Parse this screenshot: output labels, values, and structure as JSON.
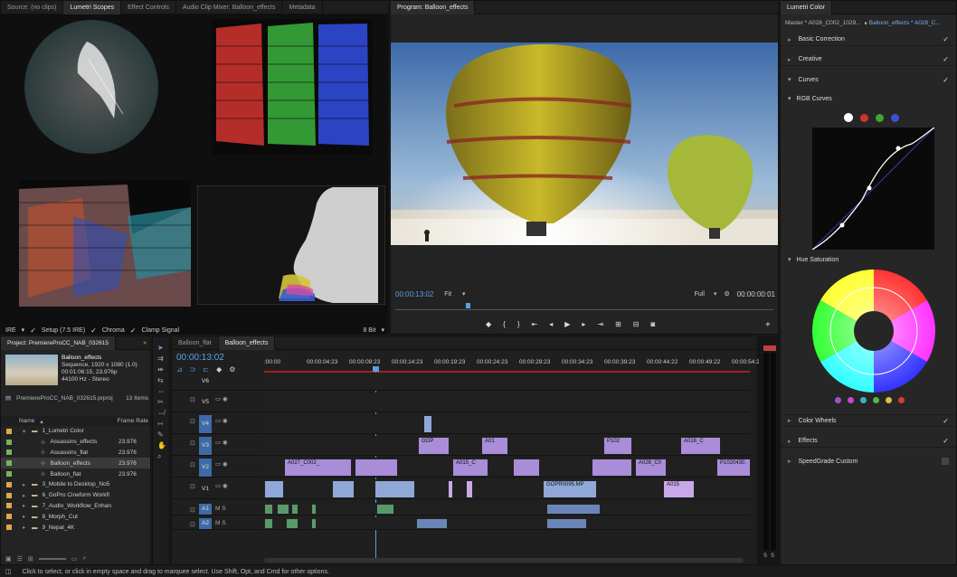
{
  "scopes": {
    "tabs": [
      "Source: (no clips)",
      "Lumetri Scopes",
      "Effect Controls",
      "Audio Clip Mixer: Balloon_effects",
      "Metadata"
    ],
    "bottom": {
      "ire": "IRE",
      "setup": "Setup (7.5 IRE)",
      "chroma": "Chroma",
      "clamp": "Clamp Signal",
      "bits": "8 Bit"
    }
  },
  "program": {
    "tab": "Program: Balloon_effects",
    "timecode": "00:00:13:02",
    "fit": "Fit",
    "quality": "Full",
    "duration": "00:00:00:01"
  },
  "lumetri": {
    "tab": "Lumetri Color",
    "master": "Master * A028_C002_1029...",
    "clip": "Balloon_effects * A028_C...",
    "sections": {
      "basic": "Basic Correction",
      "creative": "Creative",
      "curves": "Curves",
      "rgb": "RGB Curves",
      "hue": "Hue Saturation",
      "wheels": "Color Wheels",
      "effects": "Effects",
      "speedgrade": "SpeedGrade Custom"
    },
    "curve_colors": [
      "#ffffff",
      "#d2332e",
      "#3fa535",
      "#3c4fd6"
    ],
    "hue_dots": [
      "#a34fd1",
      "#c64ad0",
      "#3fb0c8",
      "#4fb84a",
      "#d7c43d",
      "#d24032"
    ]
  },
  "project": {
    "title": "Project: PremiereProCC_NAB_032615",
    "clip_name": "Balloon_effects",
    "clip_info1": "Sequence, 1920 x 1080 (1.0)",
    "clip_info2": "00:01:06:15, 23.976p",
    "clip_info3": "44100 Hz - Stereo",
    "proj_file": "PremiereProCC_NAB_032615.prproj",
    "items_count": "13 Items",
    "col_name": "Name",
    "col_rate": "Frame Rate",
    "items": [
      {
        "name": "1_Lumetri Color",
        "rate": "",
        "color": "#e0a84a",
        "indent": 0,
        "folder": true
      },
      {
        "name": "Assassins_effects",
        "rate": "23.976",
        "color": "#76b35c",
        "indent": 1,
        "folder": false
      },
      {
        "name": "Assassins_flat",
        "rate": "23.976",
        "color": "#76b35c",
        "indent": 1,
        "folder": false
      },
      {
        "name": "Balloon_effects",
        "rate": "23.976",
        "color": "#76b35c",
        "indent": 1,
        "folder": false
      },
      {
        "name": "Balloon_flat",
        "rate": "23.976",
        "color": "#76b35c",
        "indent": 1,
        "folder": false
      },
      {
        "name": "3_Mobile to Desktop_No5",
        "rate": "",
        "color": "#e0a84a",
        "indent": 0,
        "folder": true
      },
      {
        "name": "6_GoPro Cineform Workfl",
        "rate": "",
        "color": "#e0a84a",
        "indent": 0,
        "folder": true
      },
      {
        "name": "7_Audio_Workflow_Enhan",
        "rate": "",
        "color": "#e0a84a",
        "indent": 0,
        "folder": true
      },
      {
        "name": "8_Morph_Cut",
        "rate": "",
        "color": "#e0a84a",
        "indent": 0,
        "folder": true
      },
      {
        "name": "9_Nepal_4K",
        "rate": "",
        "color": "#e0a84a",
        "indent": 0,
        "folder": true
      }
    ]
  },
  "timeline": {
    "tabs": [
      "Balloon_flat",
      "Balloon_effects"
    ],
    "timecode": "00:00:13:02",
    "ruler": [
      ":00:00",
      "00:00:04:23",
      "00:00:09:23",
      "00:00:14:23",
      "00:00:19:23",
      "00:00:24:23",
      "00:00:29:23",
      "00:00:34:23",
      "00:00:39:23",
      "00:00:44:22",
      "00:00:49:22",
      "00:00:54:22"
    ],
    "tracks": [
      "V6",
      "V5",
      "V4",
      "V3",
      "V2",
      "V1",
      "A1",
      "A2"
    ],
    "clip_labels": {
      "gop1": "GOP",
      "a01": "A01",
      "p102": "P102",
      "a028": "A028_C",
      "a027": "A027_C002_",
      "a015": "A015_C",
      "a028b": "A028_C0",
      "p1020430": "P1020430.",
      "gopr0095": "GOPR0095.MP",
      "a015b": "A015"
    }
  },
  "meter": {
    "s1": "S",
    "s2": "S"
  },
  "status": {
    "text": "Click to select, or click in empty space and drag to marquee select. Use Shift, Opt, and Cmd for other options."
  }
}
